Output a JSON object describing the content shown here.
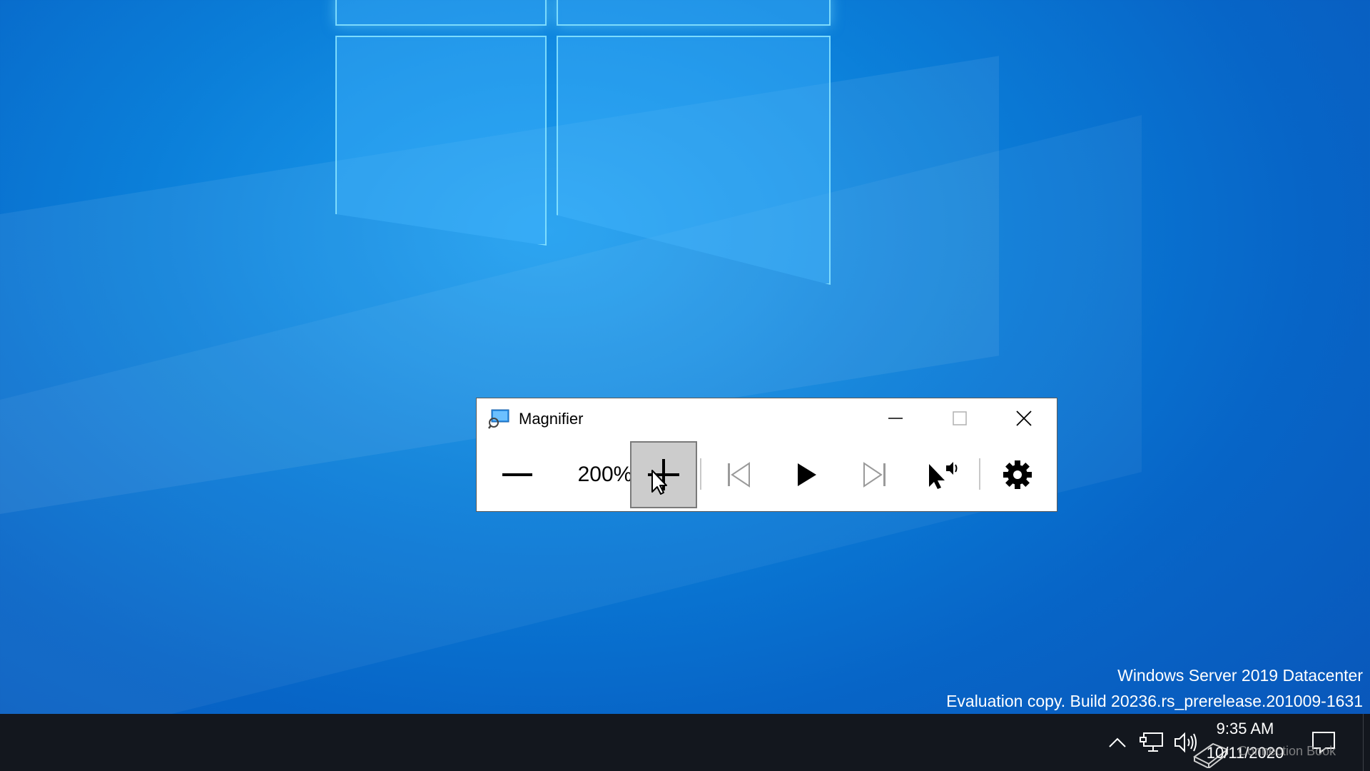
{
  "desktop": {
    "wallpaper": "windows-10-hero"
  },
  "magnifier": {
    "title": "Magnifier",
    "zoom_level": "200%",
    "buttons": {
      "zoom_out": "zoom-out-icon",
      "zoom_in": "zoom-in-icon",
      "previous": "skip-previous-icon",
      "play": "play-icon",
      "next": "skip-next-icon",
      "read_from_here": "read-from-cursor-icon",
      "settings": "gear-icon"
    }
  },
  "watermark": {
    "line1": "Windows Server 2019 Datacenter",
    "line2": "Evaluation copy. Build 20236.rs_prerelease.201009-1631"
  },
  "taskbar": {
    "clock_time": "9:35 AM",
    "clock_date": "10/11/2020",
    "overlay_text": "Connection Book"
  },
  "colors": {
    "taskbar": "#13171e",
    "active_button": "#cccccc",
    "wallpaper_accent": "#0b7fd9"
  }
}
